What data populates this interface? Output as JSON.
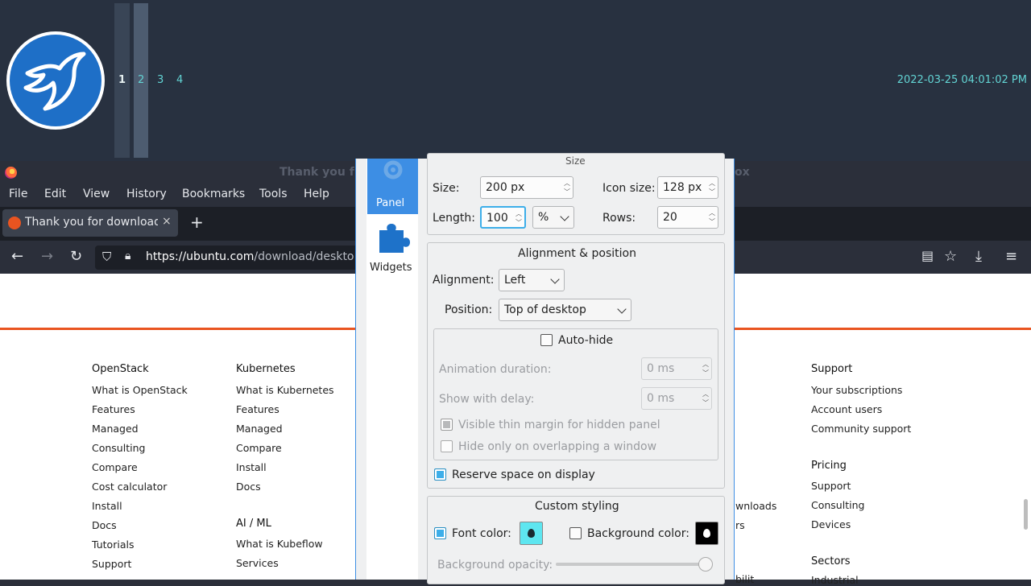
{
  "top_panel": {
    "workspaces": [
      "1",
      "2",
      "3",
      "4"
    ],
    "clock": "2022-03-25 04:01:02 PM"
  },
  "firefox": {
    "title_left": "Thank you f",
    "title_right": "ox",
    "menu": [
      "File",
      "Edit",
      "View",
      "History",
      "Bookmarks",
      "Tools",
      "Help"
    ],
    "tab_label": "Thank you for downloadi",
    "tab_close": "×",
    "new_tab": "+",
    "url_host": "https://ubuntu.com",
    "url_path": "/download/deskto"
  },
  "footer": {
    "col1": {
      "heading": "OpenStack",
      "links": [
        "What is OpenStack",
        "Features",
        "Managed",
        "Consulting",
        "Compare",
        "Cost calculator",
        "Install",
        "Docs",
        "Tutorials",
        "Support"
      ]
    },
    "col2": {
      "heading": "Kubernetes",
      "links": [
        "What is Kubernetes",
        "Features",
        "Managed",
        "Compare",
        "Install",
        "Docs"
      ]
    },
    "col2b": {
      "heading": "AI / ML",
      "links": [
        "What is Kubeflow",
        "Services"
      ]
    },
    "partial": [
      "wnloads",
      "rs",
      "bilit"
    ],
    "col4": {
      "heading": "Support",
      "links": [
        "Your subscriptions",
        "Account users",
        "Community support"
      ]
    },
    "col4b": {
      "heading": "Pricing",
      "links": [
        "Support",
        "Consulting",
        "Devices"
      ]
    },
    "col4c": {
      "heading": "Sectors",
      "links": [
        "Industrial"
      ]
    }
  },
  "dialog": {
    "tabs": {
      "panel": "Panel",
      "widgets": "Widgets"
    },
    "size_group_title": "Size",
    "size_label": "Size:",
    "size_value": "200 px",
    "icon_size_label": "Icon size:",
    "icon_size_value": "128 px",
    "length_label": "Length:",
    "length_value": "100",
    "length_unit": "%",
    "rows_label": "Rows:",
    "rows_value": "20",
    "align_group_title": "Alignment & position",
    "alignment_label": "Alignment:",
    "alignment_value": "Left",
    "position_label": "Position:",
    "position_value": "Top of desktop",
    "autohide_label": "Auto-hide",
    "anim_label": "Animation duration:",
    "anim_value": "0 ms",
    "delay_label": "Show with delay:",
    "delay_value": "0 ms",
    "thin_margin_label": "Visible thin margin for hidden panel",
    "overlap_label": "Hide only on overlapping a window",
    "reserve_label": "Reserve space on display",
    "styling_group_title": "Custom styling",
    "font_color_label": "Font color:",
    "bg_color_label": "Background color:",
    "bg_opacity_label": "Background opacity:",
    "bg_opacity_value": 1.0,
    "font_color": "#5ee6f0",
    "bg_color": "#000000"
  }
}
